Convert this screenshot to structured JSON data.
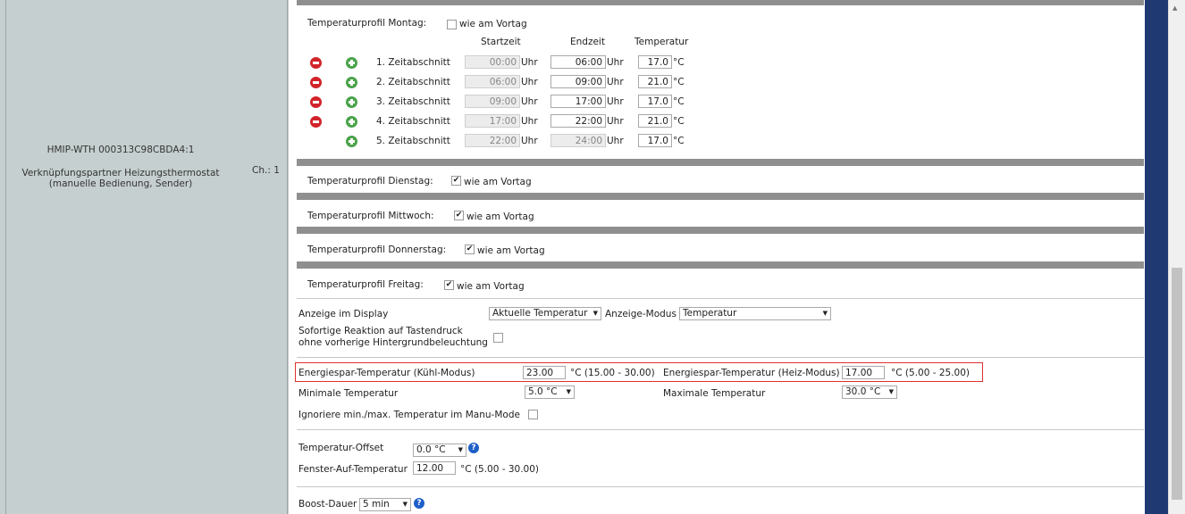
{
  "device": {
    "name": "HMIP-WTH 000313C98CBDA4:1",
    "description_line1": "Verknüpfungspartner Heizungsthermostat",
    "description_line2": "(manuelle Bedienung, Sender)",
    "channel": "Ch.: 1"
  },
  "monday": {
    "title": "Temperaturprofil Montag:",
    "same_as_previous_label": "wie am Vortag",
    "same_as_previous_checked": false,
    "headers": {
      "start": "Startzeit",
      "end": "Endzeit",
      "temp": "Temperatur"
    },
    "unit_time": "Uhr",
    "unit_temp": "°C",
    "rows": [
      {
        "label": "1. Zeitabschnitt",
        "start": "00:00",
        "end": "06:00",
        "temp": "17.0"
      },
      {
        "label": "2. Zeitabschnitt",
        "start": "06:00",
        "end": "09:00",
        "temp": "21.0"
      },
      {
        "label": "3. Zeitabschnitt",
        "start": "09:00",
        "end": "17:00",
        "temp": "17.0"
      },
      {
        "label": "4. Zeitabschnitt",
        "start": "17:00",
        "end": "22:00",
        "temp": "21.0"
      },
      {
        "label": "5. Zeitabschnitt",
        "start": "22:00",
        "end": "24:00",
        "temp": "17.0"
      }
    ]
  },
  "profiles": {
    "same_label": "wie am Vortag",
    "tuesday": "Temperaturprofil Dienstag:",
    "wednesday": "Temperaturprofil Mittwoch:",
    "thursday": "Temperaturprofil Donnerstag:",
    "friday": "Temperaturprofil Freitag:",
    "check_mark": "✔"
  },
  "display": {
    "label": "Anzeige im Display",
    "value": "Aktuelle Temperatur",
    "mode_label": "Anzeige-Modus",
    "mode_value": "Temperatur",
    "instant_line1": "Sofortige Reaktion auf Tastendruck",
    "instant_line2": "ohne vorherige Hintergrundbeleuchtung"
  },
  "energy": {
    "cool_label": "Energiespar-Temperatur (Kühl-Modus)",
    "cool_value": "23.00",
    "cool_range": "°C (15.00 - 30.00)",
    "heat_label": "Energiespar-Temperatur (Heiz-Modus)",
    "heat_value": "17.00",
    "heat_range": "°C (5.00 - 25.00)"
  },
  "limits": {
    "min_label": "Minimale Temperatur",
    "min_value": "5.0 °C",
    "max_label": "Maximale Temperatur",
    "max_value": "30.0 °C",
    "ignore_label": "Ignoriere min./max. Temperatur im Manu-Mode"
  },
  "offset": {
    "label": "Temperatur-Offset",
    "value": "0.0 °C",
    "window_label": "Fenster-Auf-Temperatur",
    "window_value": "12.00",
    "window_range": "°C (5.00 - 30.00)"
  },
  "boost": {
    "label": "Boost-Dauer",
    "value": "5 min"
  },
  "icons": {
    "help": "?",
    "caret": "▼",
    "scroll_up": "▲"
  },
  "colors": {
    "highlight": "#e03030",
    "side_panel": "#c6cfcf",
    "nav_gutter": "#1f3a73",
    "remove": "#d2232a",
    "add": "#4aa34a"
  }
}
